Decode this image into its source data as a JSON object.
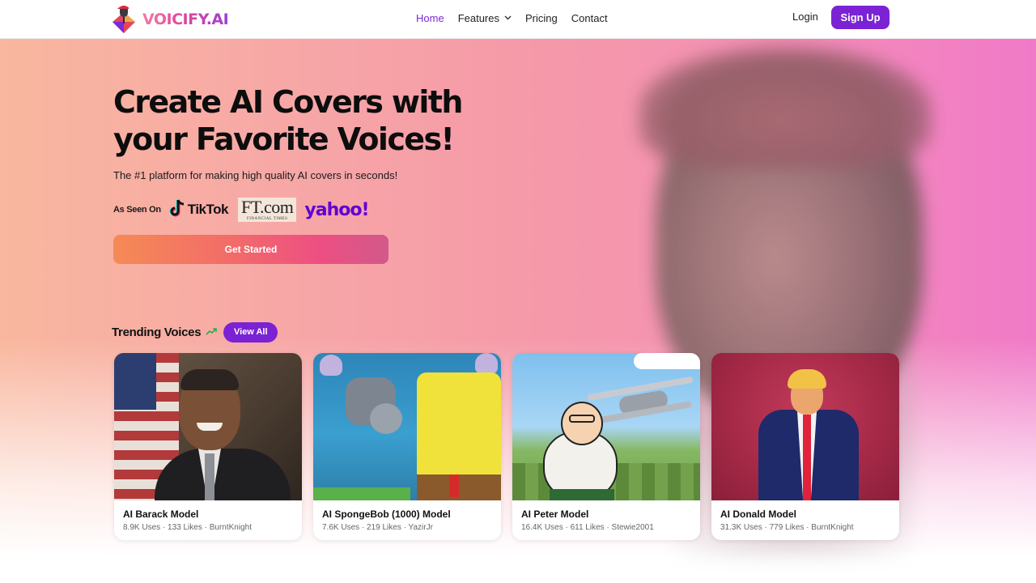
{
  "brand": {
    "name": "VOICIFY.AI"
  },
  "nav": {
    "links": [
      {
        "label": "Home",
        "active": true
      },
      {
        "label": "Features",
        "has_dropdown": true
      },
      {
        "label": "Pricing"
      },
      {
        "label": "Contact"
      }
    ],
    "login_label": "Login",
    "signup_label": "Sign Up"
  },
  "hero": {
    "title_line1": "Create AI Covers with",
    "title_line2": "your Favorite Voices!",
    "subtitle": "The #1 platform for making high quality AI covers in seconds!",
    "as_seen_on": "As Seen On",
    "press": {
      "tiktok": "TikTok",
      "ft_main": "FT.com",
      "ft_small": "FINANCIAL TIMES",
      "yahoo": "yahoo!"
    },
    "cta_label": "Get Started"
  },
  "trending": {
    "title": "Trending Voices",
    "view_all_label": "View All",
    "cards": [
      {
        "title": "AI Barack Model",
        "meta": "8.9K Uses · 133 Likes · BurntKnight"
      },
      {
        "title": "AI SpongeBob (1000) Model",
        "meta": "7.6K Uses · 219 Likes · YazirJr"
      },
      {
        "title": "AI Peter Model",
        "meta": "16.4K Uses · 611 Likes · Stewie2001"
      },
      {
        "title": "AI Donald Model",
        "meta": "31.3K Uses · 779 Likes · BurntKnight"
      }
    ]
  },
  "colors": {
    "accent": "#7b22d4",
    "cta_gradient_start": "#f58a55",
    "cta_gradient_end": "#d2598a",
    "trend_icon": "#22b04a"
  },
  "icons": {
    "features_dropdown": "chevron-down-icon",
    "trending": "trending-up-icon",
    "logo": "microphone-logo-icon"
  }
}
